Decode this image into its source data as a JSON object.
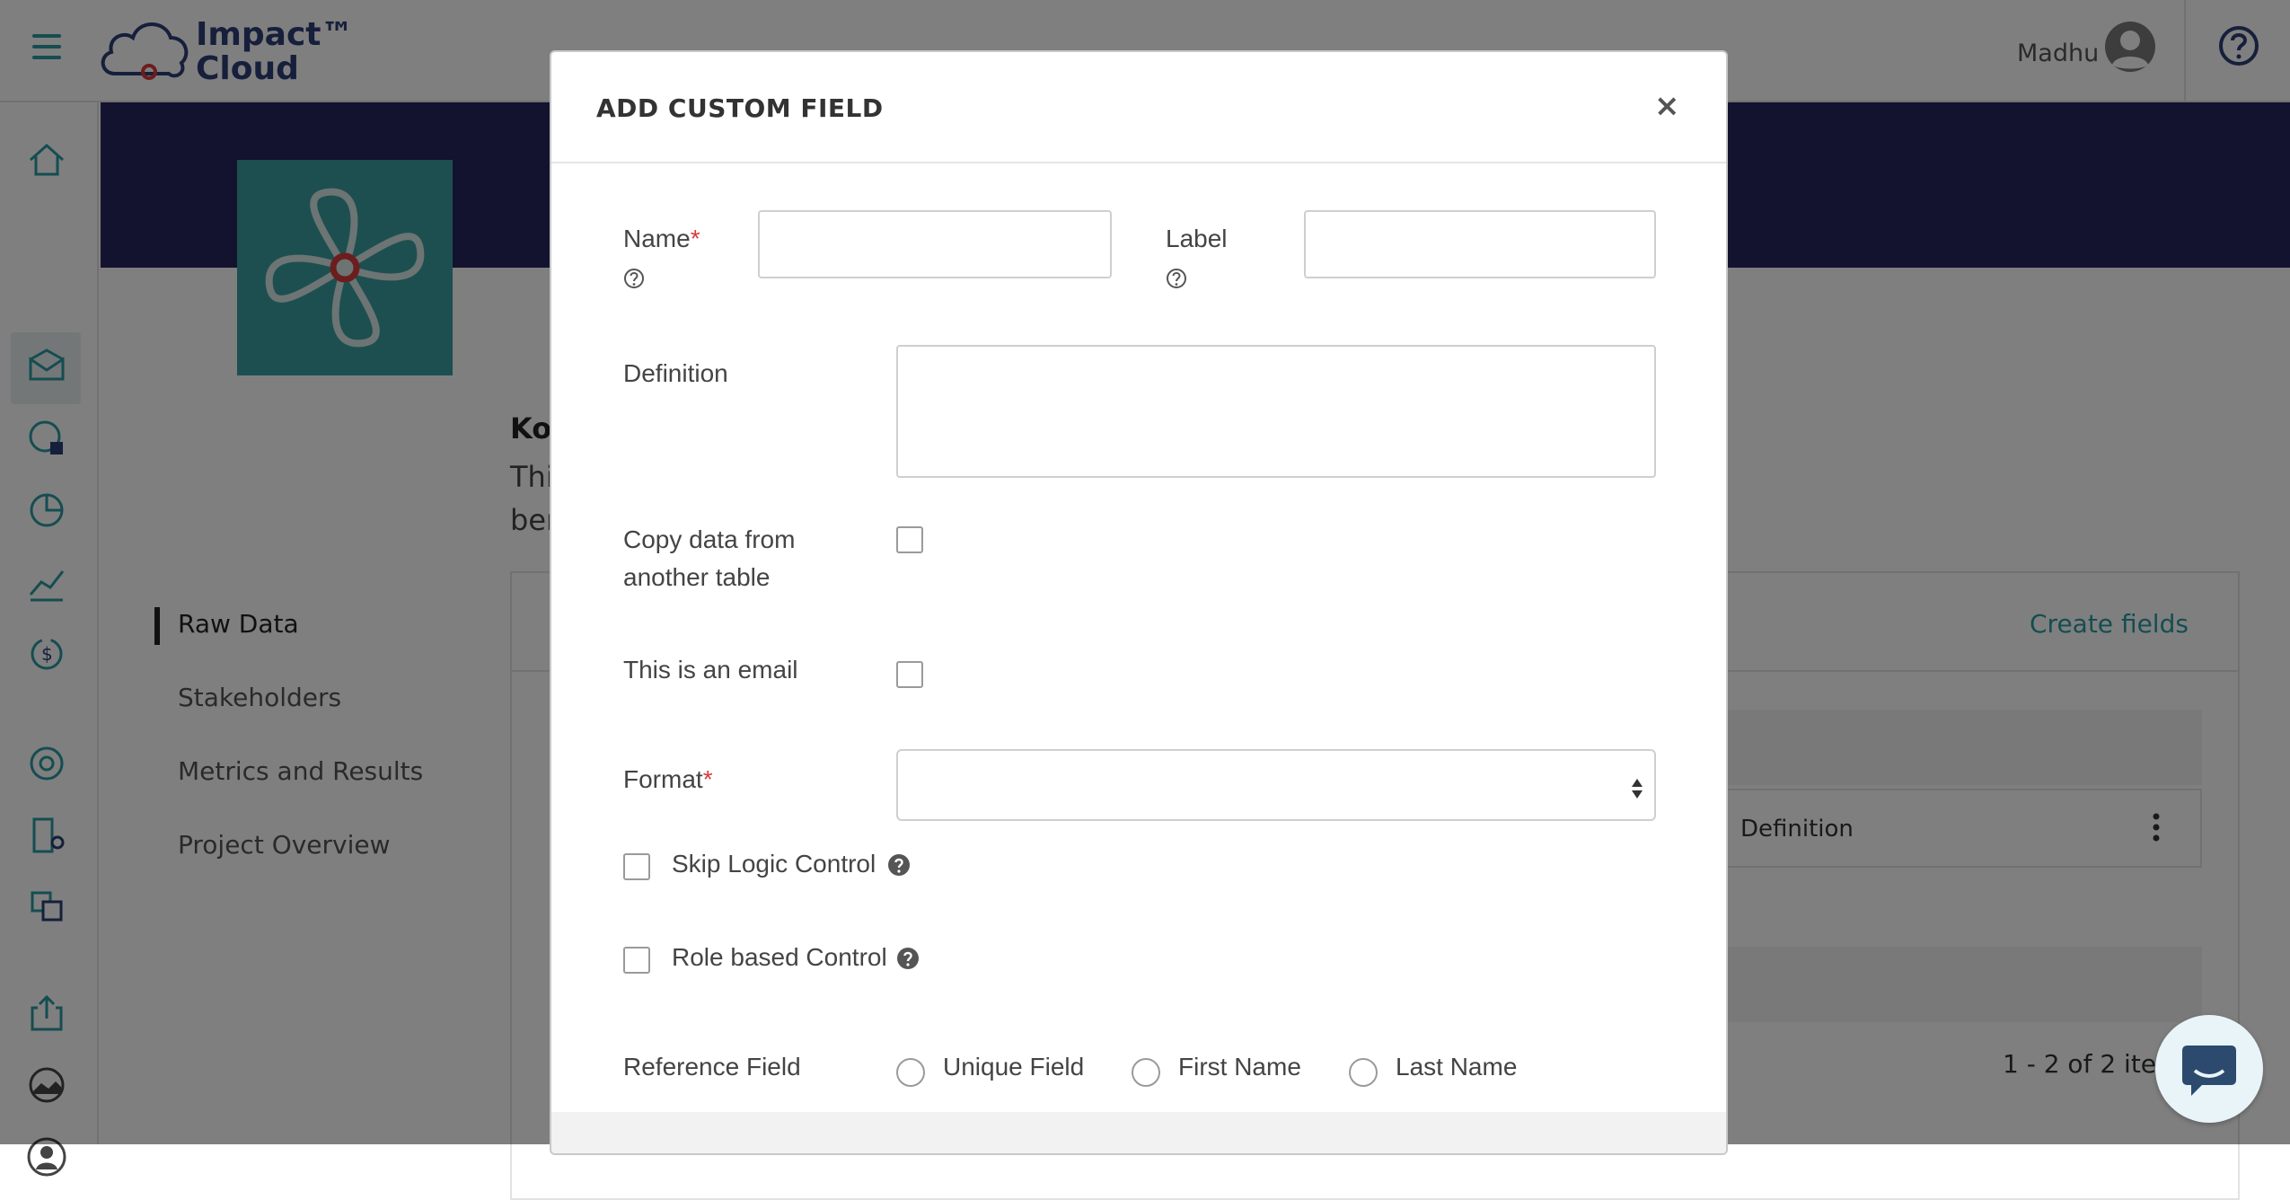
{
  "app": {
    "brand_line1": "Impact™",
    "brand_line2": "Cloud",
    "user_name": "Madhu"
  },
  "project": {
    "title_fragment": "Kol",
    "desc_fragment1": "Thi",
    "desc_fragment2": "ben"
  },
  "nav": {
    "items": [
      "Raw Data",
      "Stakeholders",
      "Metrics and Results",
      "Project Overview"
    ],
    "active": "Raw Data"
  },
  "card": {
    "create_fields_label": "Create fields",
    "row_definition": "Definition",
    "pager_text": "1 - 2 of 2 items"
  },
  "modal": {
    "title": "ADD CUSTOM FIELD",
    "close_symbol": "×",
    "name_label": "Name",
    "label_label": "Label",
    "required_mark": "*",
    "definition_label": "Definition",
    "copy_data_label_line1": "Copy data from",
    "copy_data_label_line2": "another table",
    "email_label": "This is an email",
    "format_label": "Format",
    "skip_logic_label": "Skip Logic Control",
    "role_based_label": "Role based Control",
    "reference_field_label": "Reference Field",
    "reference_options": [
      "Unique Field",
      "First Name",
      "Last Name"
    ],
    "name_value": "",
    "label_value": "",
    "definition_value": "",
    "format_value": ""
  },
  "colors": {
    "accent": "#2a9aa3",
    "banner": "#26245e",
    "required": "#d83a3a",
    "brand_text": "#2c3e76"
  }
}
